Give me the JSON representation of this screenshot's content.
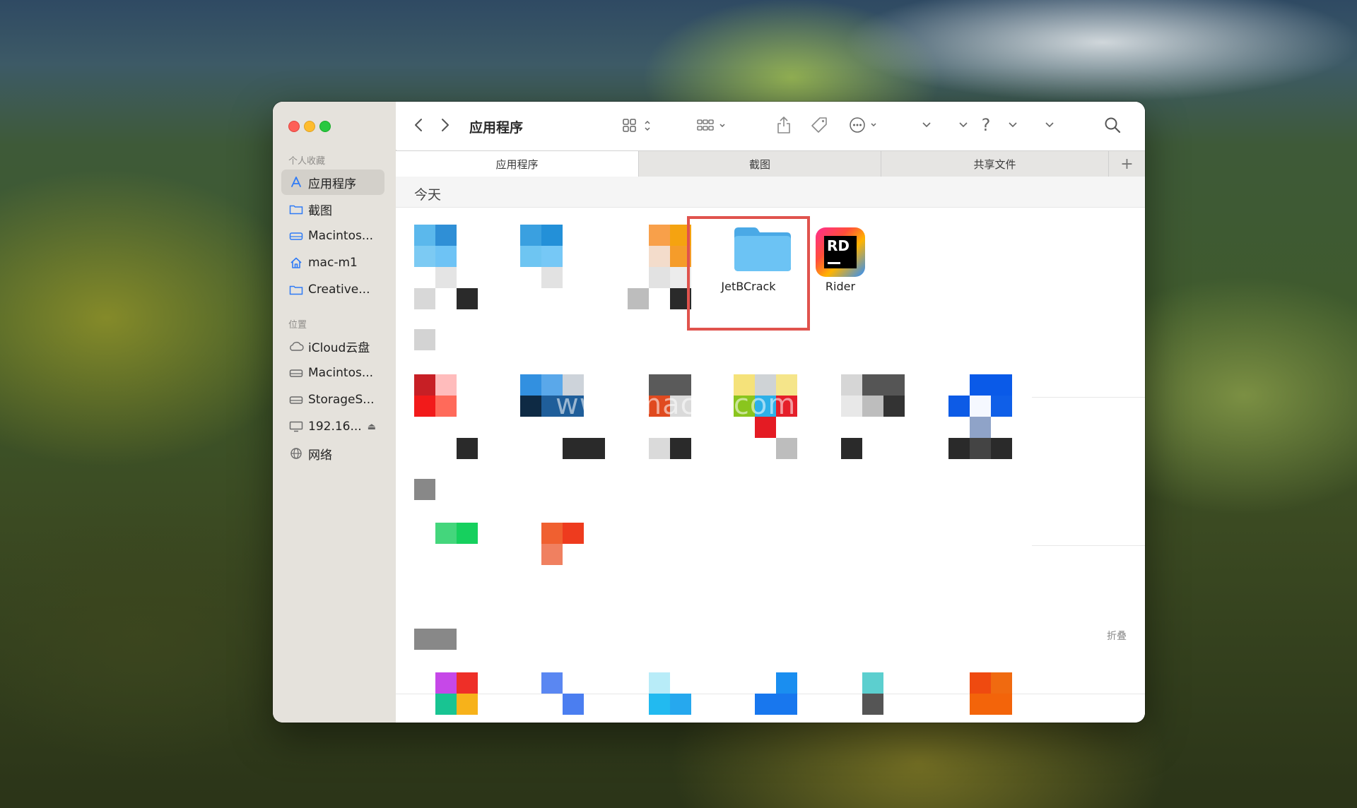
{
  "window": {
    "title": "应用程序"
  },
  "sidebar": {
    "favorites_title": "个人收藏",
    "favorites": [
      {
        "label": "应用程序",
        "icon": "app-icon",
        "selected": true
      },
      {
        "label": "截图",
        "icon": "folder-icon",
        "selected": false
      },
      {
        "label": "Macintos...",
        "icon": "drive-icon",
        "selected": false
      },
      {
        "label": "mac-m1",
        "icon": "home-icon",
        "selected": false
      },
      {
        "label": "Creative...",
        "icon": "folder-icon",
        "selected": false
      }
    ],
    "locations_title": "位置",
    "locations": [
      {
        "label": "iCloud云盘",
        "icon": "cloud-icon"
      },
      {
        "label": "Macintos...",
        "icon": "drive-icon"
      },
      {
        "label": "StorageS...",
        "icon": "drive-icon"
      },
      {
        "label": "192.16...",
        "icon": "display-icon"
      },
      {
        "label": "网络",
        "icon": "globe-icon"
      }
    ]
  },
  "tabs": [
    {
      "label": "应用程序",
      "active": true
    },
    {
      "label": "截图",
      "active": false
    },
    {
      "label": "共享文件",
      "active": false
    }
  ],
  "content": {
    "group_label": "今天",
    "collapse_label": "折叠",
    "items": [
      {
        "label": "JetBCrack",
        "icon": "folder-icon"
      },
      {
        "label": "Rider",
        "icon": "rider-app-icon",
        "badge": "RD"
      }
    ]
  },
  "watermark": "www.macjb.com",
  "colors": {
    "accent": "#2f7bf6",
    "highlight": "#e0534d",
    "folder": "#5bb9f0"
  }
}
